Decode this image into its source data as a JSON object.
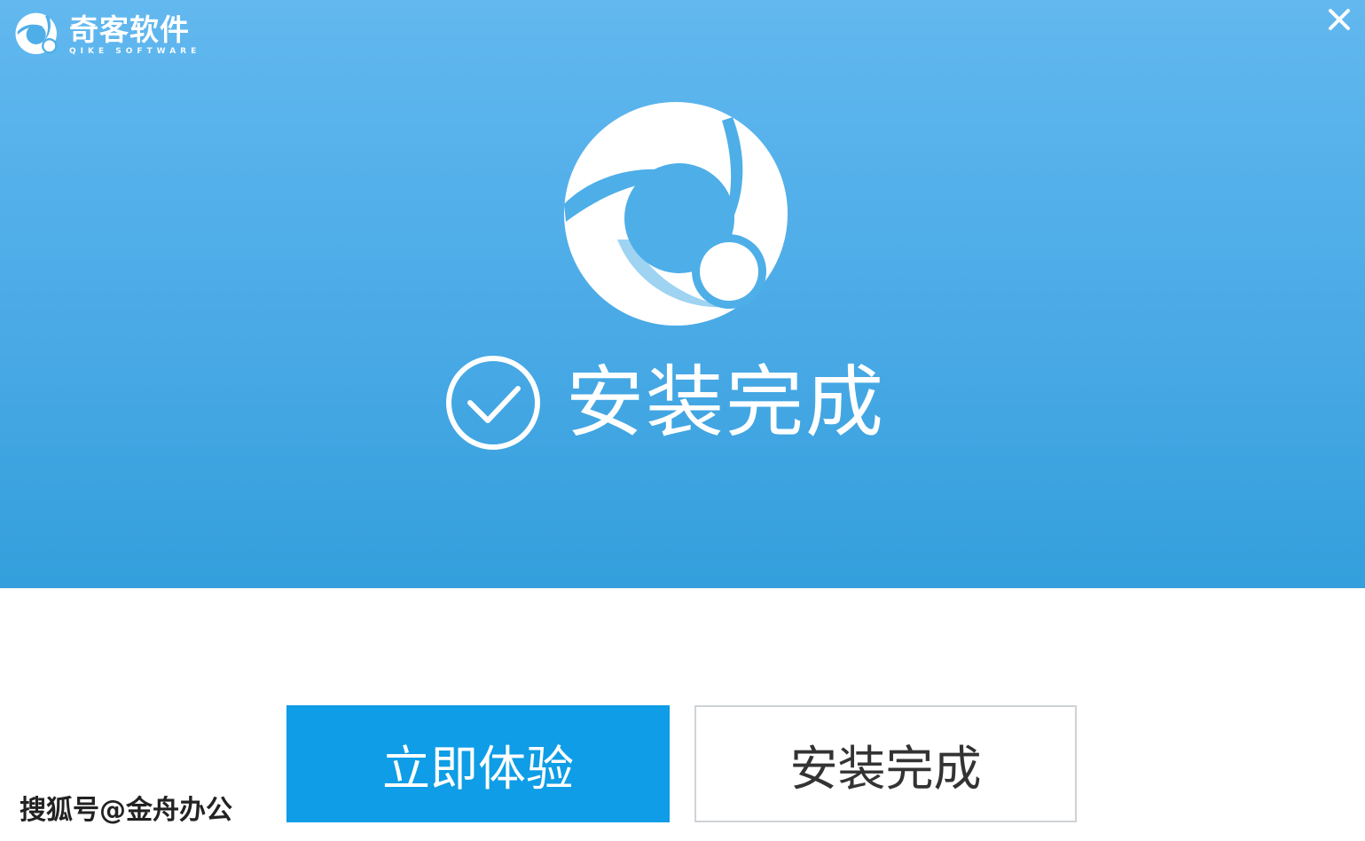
{
  "brand": {
    "name": "奇客软件",
    "subtitle": "QIKE SOFTWARE",
    "logo_icon": "qike-logo-icon"
  },
  "window": {
    "close_icon": "close-icon"
  },
  "hero": {
    "logo_icon": "qike-logo-icon",
    "status_icon": "check-circle-icon",
    "status_text": "安装完成"
  },
  "buttons": {
    "primary_label": "立即体验",
    "secondary_label": "安装完成"
  },
  "watermark": {
    "text": "搜狐号@金舟办公"
  },
  "colors": {
    "banner_top": "#62b8ef",
    "banner_bottom": "#339fdc",
    "primary_button": "#0e9de6",
    "secondary_border": "#cfd3d6"
  }
}
